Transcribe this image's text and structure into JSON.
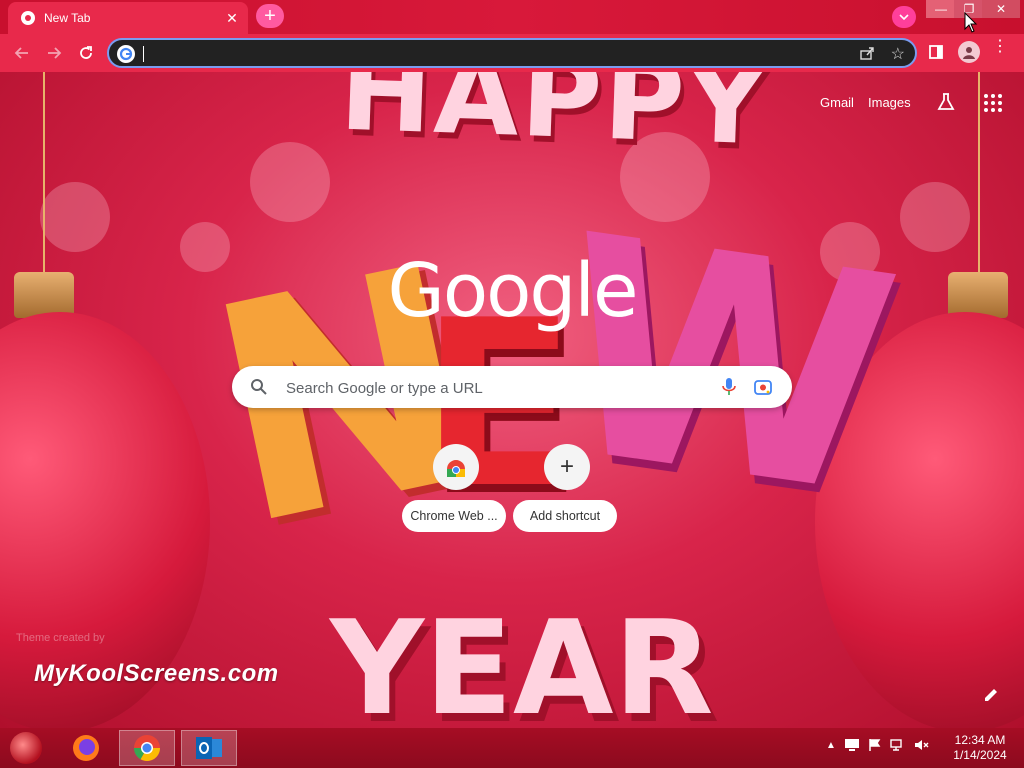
{
  "browser": {
    "tab_title": "New Tab",
    "tab_close": "✕",
    "new_tab": "+",
    "window_controls": {
      "minimize": "—",
      "restore": "❐",
      "close": "✕"
    }
  },
  "toolbar": {
    "back_icon": "arrow-left-icon",
    "forward_icon": "arrow-right-icon",
    "reload_icon": "reload-icon",
    "address_value": "",
    "bookmark_star": "☆",
    "menu": "⋮"
  },
  "header_links": {
    "gmail": "Gmail",
    "images": "Images"
  },
  "logo_text": "Google",
  "search": {
    "placeholder": "Search Google or type a URL"
  },
  "shortcuts": [
    {
      "label": "Chrome Web ...",
      "icon": "chrome-web-store-icon"
    },
    {
      "label": "Add shortcut",
      "icon": "plus-icon",
      "glyph": "+"
    }
  ],
  "background": {
    "theme_credit": "Theme created by",
    "brand": "MyKoolScreens.com",
    "word_top": "HAPPY",
    "word_bottom": "YEAR",
    "new_letters": [
      "N",
      "E",
      "W"
    ]
  },
  "taskbar": {
    "time": "12:34 AM",
    "date": "1/14/2024",
    "tray_up": "▲"
  },
  "colors": {
    "accent": "#e8294b",
    "background": "#b5102a",
    "omnibox_border": "#7a9cf0"
  }
}
